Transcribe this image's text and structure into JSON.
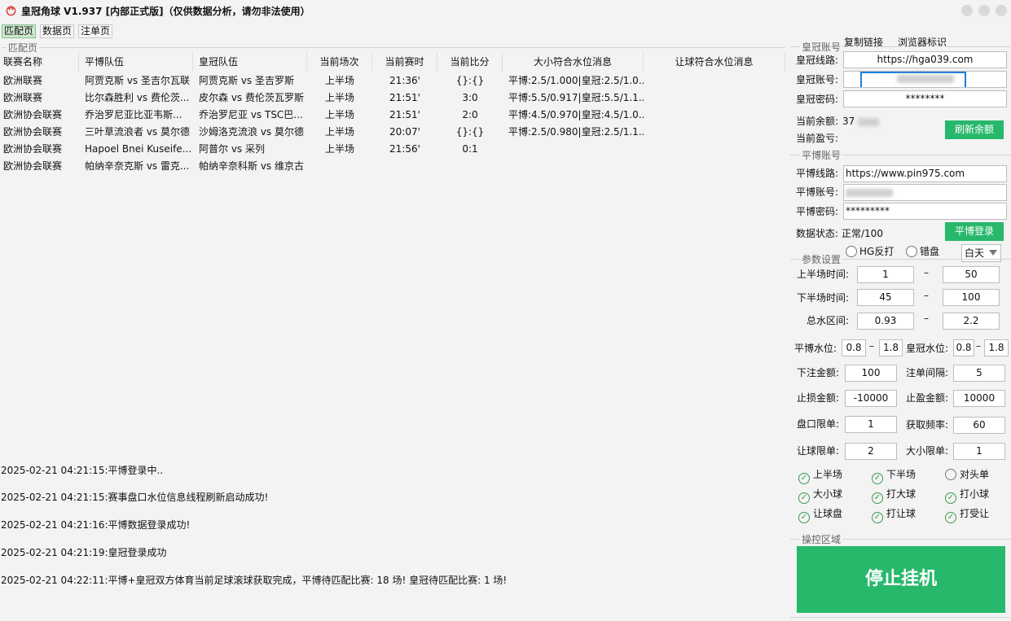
{
  "app": {
    "title": "皇冠角球 V1.937 [内部正式版]（仅供数据分析，请勿非法使用）"
  },
  "tabs": [
    {
      "label": "匹配页"
    },
    {
      "label": "数据页"
    },
    {
      "label": "注单页"
    }
  ],
  "match_section": {
    "group_label": "匹配页",
    "columns": [
      "联赛名称",
      "平博队伍",
      "皇冠队伍",
      "当前场次",
      "当前赛时",
      "当前比分",
      "大小符合水位消息",
      "让球符合水位消息"
    ],
    "rows": [
      [
        "欧洲联赛",
        "阿贾克斯 vs 圣吉尔瓦联",
        "阿贾克斯 vs 圣吉罗斯",
        "上半场",
        "21:36'",
        "{}:{}",
        "平博:2.5/1.000|皇冠:2.5/1.0...",
        ""
      ],
      [
        "欧洲联赛",
        "比尔森胜利 vs 费伦茨...",
        "皮尔森 vs 费伦茨瓦罗斯",
        "上半场",
        "21:51'",
        "3:0",
        "平博:5.5/0.917|皇冠:5.5/1.1...",
        ""
      ],
      [
        "欧洲协会联赛",
        "乔治罗尼亚比亚韦斯...",
        "乔治罗尼亚 vs TSC巴...",
        "上半场",
        "21:51'",
        "2:0",
        "平博:4.5/0.970|皇冠:4.5/1.0...",
        ""
      ],
      [
        "欧洲协会联赛",
        "三叶草流浪者 vs 莫尔德",
        "沙姆洛克流浪 vs 莫尔德",
        "上半场",
        "20:07'",
        "{}:{}",
        "平博:2.5/0.980|皇冠:2.5/1.1...",
        ""
      ],
      [
        "欧洲协会联赛",
        "Hapoel Bnei Kuseife...",
        "阿普尔 vs 采列",
        "上半场",
        "21:56'",
        "0:1",
        "",
        ""
      ],
      [
        "欧洲协会联赛",
        "帕纳辛奈克斯 vs 雷克...",
        "帕纳辛奈科斯 vs 维京古",
        "",
        "",
        "",
        "",
        ""
      ]
    ]
  },
  "logs": [
    "2025-02-21 04:21:15:平博登录中..",
    "2025-02-21 04:21:15:赛事盘口水位信息线程刷新启动成功!",
    "2025-02-21 04:21:16:平博数据登录成功!",
    "2025-02-21 04:21:19:皇冠登录成功",
    "2025-02-21 04:22:11:平博+皇冠双方体育当前足球滚球获取完成，平博待匹配比赛: 18 场! 皇冠待匹配比赛: 1 场!"
  ],
  "crown": {
    "group_label": "皇冠账号",
    "copy_link": "复制链接",
    "browser_id": "浏览器标识",
    "line_label": "皇冠线路:",
    "line_value": "https://hga039.com",
    "account_label": "皇冠账号:",
    "password_label": "皇冠密码:",
    "password_value": "********",
    "balance_label": "当前余额:",
    "balance_visible": "37",
    "profit_label": "当前盈亏:",
    "refresh_button": "刷新余额"
  },
  "pinnacle": {
    "group_label": "平博账号",
    "line_label": "平博线路:",
    "line_value": "https://www.pin975.com",
    "account_label": "平博账号:",
    "password_label": "平博密码:",
    "password_value": "*********",
    "status_label": "数据状态:",
    "status_value": "正常/100",
    "login_button": "平博登录"
  },
  "options": {
    "hg_reverse": "HG反打",
    "wrong_plate": "错盘",
    "mode_select": "白天"
  },
  "params": {
    "group_label": "参数设置",
    "first_half_label": "上半场时间:",
    "first_half_min": "1",
    "first_half_max": "50",
    "second_half_label": "下半场时间:",
    "second_half_min": "45",
    "second_half_max": "100",
    "total_water_label": "总水区间:",
    "total_water_min": "0.93",
    "total_water_max": "2.2",
    "pin_water_label": "平博水位:",
    "pin_water_min": "0.8",
    "pin_water_max": "1.8",
    "crown_water_label": "皇冠水位:",
    "crown_water_min": "0.8",
    "crown_water_max": "1.8",
    "bet_amount_label": "下注金额:",
    "bet_amount": "100",
    "bet_interval_label": "注单间隔:",
    "bet_interval": "5",
    "stop_loss_label": "止损金额:",
    "stop_loss": "-10000",
    "take_profit_label": "止盈金额:",
    "take_profit": "10000",
    "plate_limit_label": "盘口限单:",
    "plate_limit": "1",
    "fetch_freq_label": "获取频率:",
    "fetch_freq": "60",
    "handicap_limit_label": "让球限单:",
    "handicap_limit": "2",
    "overunder_limit_label": "大小限单:",
    "overunder_limit": "1",
    "dash": "–"
  },
  "checks": [
    {
      "label": "上半场",
      "checked": true
    },
    {
      "label": "下半场",
      "checked": true
    },
    {
      "label": "对头单",
      "checked": false
    },
    {
      "label": "大小球",
      "checked": true
    },
    {
      "label": "打大球",
      "checked": true
    },
    {
      "label": "打小球",
      "checked": true
    },
    {
      "label": "让球盘",
      "checked": true
    },
    {
      "label": "打让球",
      "checked": true
    },
    {
      "label": "打受让",
      "checked": true
    }
  ],
  "control": {
    "group_label": "操控区域",
    "stop_button": "停止挂机"
  },
  "colors": {
    "accent_green": "#28b86c",
    "tab_active": "#cce8cf",
    "focus_blue": "#1e7fd8"
  }
}
